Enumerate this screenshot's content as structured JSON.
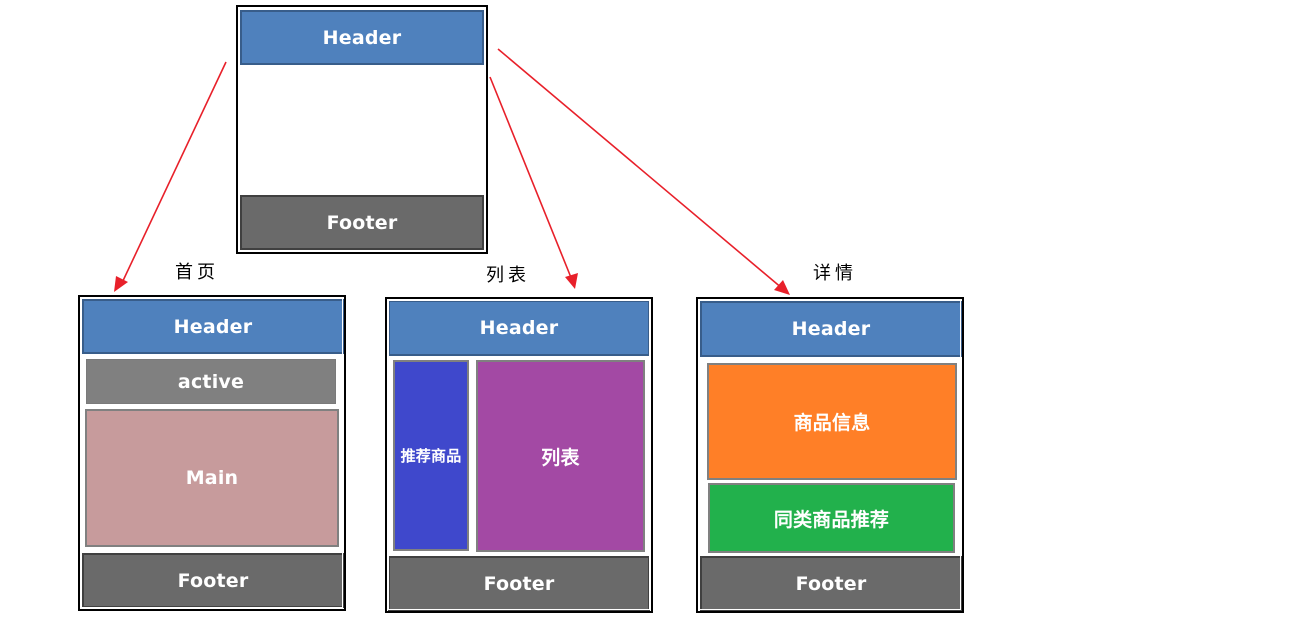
{
  "template": {
    "header_label": "Header",
    "footer_label": "Footer"
  },
  "pages": [
    {
      "caption": "首页",
      "header_label": "Header",
      "blocks": [
        "active",
        "Main"
      ],
      "footer_label": "Footer"
    },
    {
      "caption": "列表",
      "header_label": "Header",
      "blocks": [
        "推荐商品",
        "列表"
      ],
      "footer_label": "Footer"
    },
    {
      "caption": "详情",
      "header_label": "Header",
      "blocks": [
        "商品信息",
        "同类商品推荐"
      ],
      "footer_label": "Footer"
    }
  ],
  "colors": {
    "header": "#4f81bd",
    "footer": "#6a6a6a",
    "active": "#808080",
    "main": "#c79b9c",
    "recommend": "#3f48cc",
    "list": "#a349a4",
    "product_info": "#ff7f27",
    "similar_products": "#22b14c",
    "arrow": "#e8202a"
  }
}
